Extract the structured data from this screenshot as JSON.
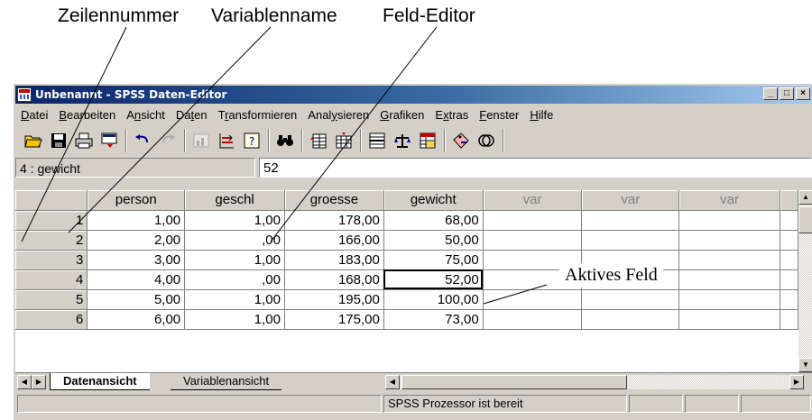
{
  "annotations": {
    "row_number": "Zeilennummer",
    "variable_name": "Variablenname",
    "field_editor": "Feld-Editor",
    "active_field": "Aktives Feld"
  },
  "window": {
    "title": "Unbenannt - SPSS Daten-Editor",
    "minimize": "_",
    "maximize": "□",
    "close": "×"
  },
  "menu": [
    {
      "label": "Datei",
      "underline": "D"
    },
    {
      "label": "Bearbeiten",
      "underline": "B"
    },
    {
      "label": "Ansicht",
      "underline": "n"
    },
    {
      "label": "Daten",
      "underline": "t"
    },
    {
      "label": "Transformieren",
      "underline": "r"
    },
    {
      "label": "Analysieren",
      "underline": "y"
    },
    {
      "label": "Grafiken",
      "underline": "G"
    },
    {
      "label": "Extras",
      "underline": "x"
    },
    {
      "label": "Fenster",
      "underline": "F"
    },
    {
      "label": "Hilfe",
      "underline": "H"
    }
  ],
  "toolbar": {
    "icons": [
      "open-icon",
      "save-icon",
      "print-icon",
      "dialog-recall-icon",
      "undo-icon",
      "redo-icon",
      "goto-chart-icon",
      "goto-case-icon",
      "variables-icon",
      "find-icon",
      "insert-cases-icon",
      "insert-variable-icon",
      "split-file-icon",
      "weight-cases-icon",
      "select-cases-icon",
      "value-labels-icon",
      "use-sets-icon"
    ]
  },
  "cell_editor": {
    "reference": "4 : gewicht",
    "value": "52"
  },
  "grid": {
    "columns": [
      "person",
      "geschl",
      "groesse",
      "gewicht",
      "var",
      "var",
      "var"
    ],
    "rows": [
      {
        "n": "1",
        "cells": [
          "1,00",
          "1,00",
          "178,00",
          "68,00"
        ]
      },
      {
        "n": "2",
        "cells": [
          "2,00",
          ",00",
          "166,00",
          "50,00"
        ]
      },
      {
        "n": "3",
        "cells": [
          "3,00",
          "1,00",
          "183,00",
          "75,00"
        ]
      },
      {
        "n": "4",
        "cells": [
          "4,00",
          ",00",
          "168,00",
          "52,00"
        ]
      },
      {
        "n": "5",
        "cells": [
          "5,00",
          "1,00",
          "195,00",
          "100,00"
        ]
      },
      {
        "n": "6",
        "cells": [
          "6,00",
          "1,00",
          "175,00",
          "73,00"
        ]
      }
    ],
    "active_cell": {
      "row": 4,
      "column": "gewicht"
    }
  },
  "tabs": {
    "data_view": "Datenansicht",
    "variable_view": "Variablenansicht"
  },
  "status": {
    "processor": "SPSS Prozessor  ist bereit"
  }
}
